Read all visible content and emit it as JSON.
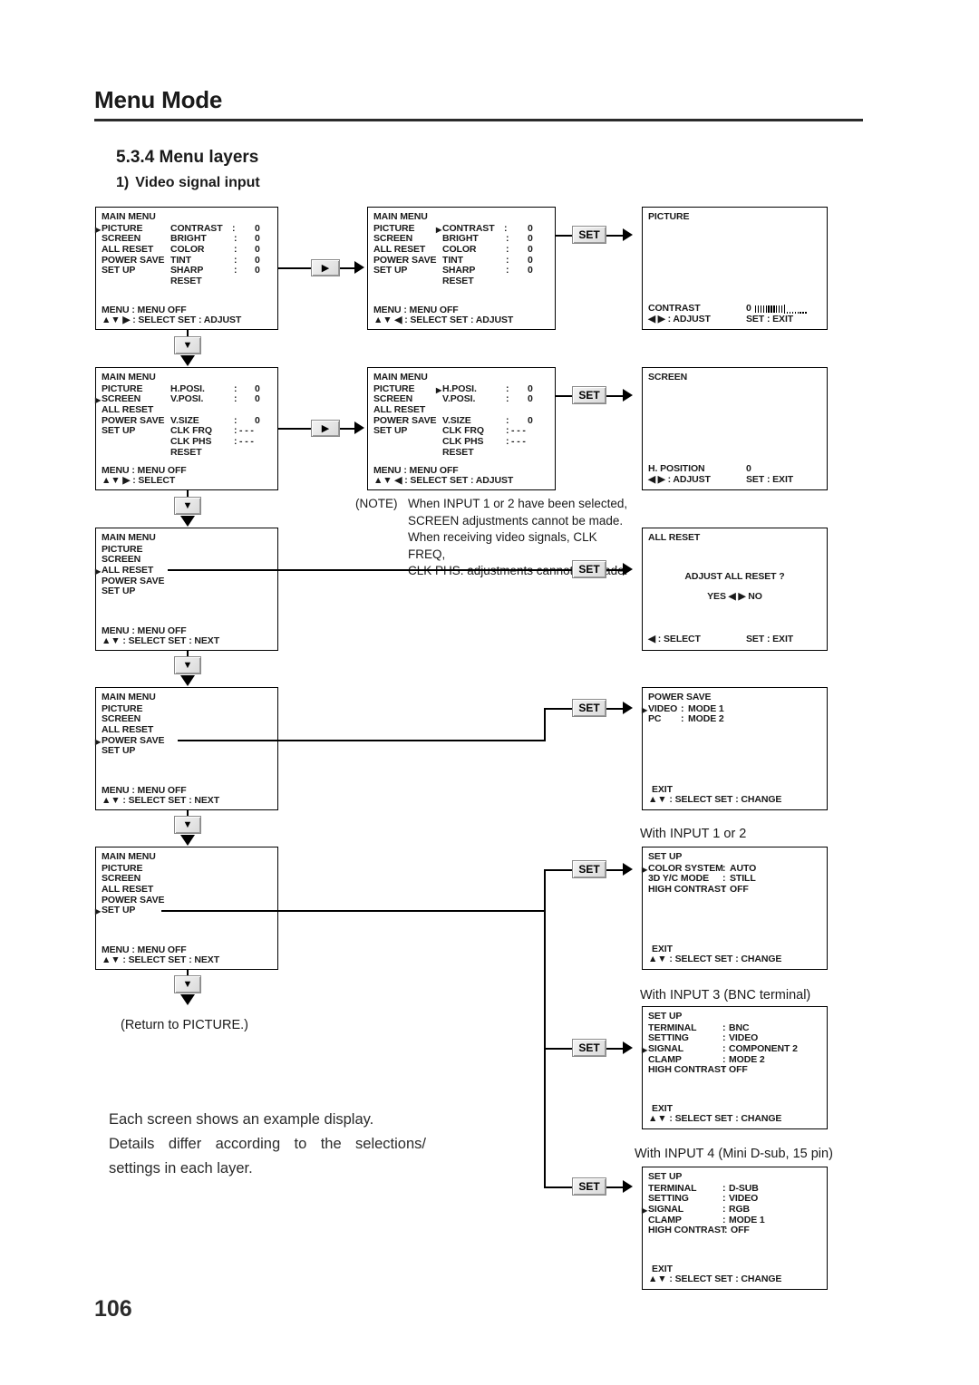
{
  "page": {
    "title": "Menu Mode",
    "section": "5.3.4 Menu layers",
    "subsection_number": "1)",
    "subsection": "Video signal input",
    "page_number": "106"
  },
  "buttons": {
    "set": "SET",
    "right_arrow": "▶",
    "down_arrow": "▼"
  },
  "panels": {
    "main_picture": {
      "header": "MAIN MENU",
      "left_items": [
        "PICTURE",
        "SCREEN",
        "ALL RESET",
        "POWER SAVE",
        "SET UP"
      ],
      "left_cursor_index": 0,
      "right_items": [
        {
          "label": "CONTRAST",
          "colon": ":",
          "value": "0"
        },
        {
          "label": "BRIGHT",
          "colon": ":",
          "value": "0"
        },
        {
          "label": "COLOR",
          "colon": ":",
          "value": "0"
        },
        {
          "label": "TINT",
          "colon": ":",
          "value": "0"
        },
        {
          "label": "SHARP",
          "colon": ":",
          "value": "0"
        },
        {
          "label": "RESET",
          "colon": "",
          "value": ""
        }
      ],
      "right_cursor_index": -1,
      "footer_line1": "MENU : MENU OFF",
      "footer_line2": "▲▼ ▶ : SELECT   SET : ADJUST"
    },
    "main_picture_contrast": {
      "header": "MAIN MENU",
      "left_items": [
        "PICTURE",
        "SCREEN",
        "ALL RESET",
        "POWER SAVE",
        "SET UP"
      ],
      "left_cursor_index": -1,
      "right_items": [
        {
          "label": "CONTRAST",
          "colon": ":",
          "value": "0"
        },
        {
          "label": "BRIGHT",
          "colon": ":",
          "value": "0"
        },
        {
          "label": "COLOR",
          "colon": ":",
          "value": "0"
        },
        {
          "label": "TINT",
          "colon": ":",
          "value": "0"
        },
        {
          "label": "SHARP",
          "colon": ":",
          "value": "0"
        },
        {
          "label": "RESET",
          "colon": "",
          "value": ""
        }
      ],
      "right_cursor_index": 0,
      "footer_line1": "MENU : MENU OFF",
      "footer_line2": "▲▼ ◀ : SELECT   SET : ADJUST"
    },
    "picture_screen": {
      "header": "PICTURE",
      "adjust_label": "CONTRAST",
      "adjust_value": "0",
      "footer_left": "◀ ▶ : ADJUST",
      "footer_right": "SET : EXIT"
    },
    "main_screen": {
      "header": "MAIN MENU",
      "left_items": [
        "PICTURE",
        "SCREEN",
        "ALL RESET",
        "POWER SAVE",
        "SET UP"
      ],
      "left_cursor_index": 1,
      "right_items": [
        {
          "label": "H.POSI.",
          "colon": ":",
          "value": "0"
        },
        {
          "label": "V.POSI.",
          "colon": ":",
          "value": "0"
        },
        {
          "label": "",
          "colon": "",
          "value": ""
        },
        {
          "label": "V.SIZE",
          "colon": ":",
          "value": "0"
        },
        {
          "label": "CLK FRQ",
          "colon": ":",
          "value": "- - -"
        },
        {
          "label": "CLK PHS",
          "colon": ":",
          "value": "- - -"
        },
        {
          "label": "RESET",
          "colon": "",
          "value": ""
        }
      ],
      "right_cursor_index": -1,
      "footer_line1": "MENU : MENU OFF",
      "footer_line2": "▲▼ ▶ : SELECT"
    },
    "main_screen_hposi": {
      "header": "MAIN MENU",
      "left_items": [
        "PICTURE",
        "SCREEN",
        "ALL RESET",
        "POWER SAVE",
        "SET UP"
      ],
      "left_cursor_index": -1,
      "right_items": [
        {
          "label": "H.POSI.",
          "colon": ":",
          "value": "0"
        },
        {
          "label": "V.POSI.",
          "colon": ":",
          "value": "0"
        },
        {
          "label": "",
          "colon": "",
          "value": ""
        },
        {
          "label": "V.SIZE",
          "colon": ":",
          "value": "0"
        },
        {
          "label": "CLK FRQ",
          "colon": ":",
          "value": "- - -"
        },
        {
          "label": "CLK PHS",
          "colon": ":",
          "value": "- - -"
        },
        {
          "label": "RESET",
          "colon": "",
          "value": ""
        }
      ],
      "right_cursor_index": 0,
      "footer_line1": "MENU : MENU OFF",
      "footer_line2": "▲▼ ◀ : SELECT   SET : ADJUST"
    },
    "screen_screen": {
      "header": "SCREEN",
      "adjust_label": "H. POSITION",
      "adjust_value": "0",
      "footer_left": "◀ ▶ : ADJUST",
      "footer_right": "SET : EXIT"
    },
    "main_allreset": {
      "header": "MAIN MENU",
      "left_items": [
        "PICTURE",
        "SCREEN",
        "ALL RESET",
        "POWER SAVE",
        "SET UP"
      ],
      "left_cursor_index": 2,
      "footer_line1": "MENU : MENU OFF",
      "footer_line2": "▲▼    : SELECT   SET : NEXT"
    },
    "allreset_screen": {
      "header": "ALL RESET",
      "prompt": "ADJUST ALL RESET ?",
      "choices": "YES ◀  ▶ NO",
      "footer_left": "◀    : SELECT",
      "footer_right": "SET : EXIT"
    },
    "main_powersave": {
      "header": "MAIN MENU",
      "left_items": [
        "PICTURE",
        "SCREEN",
        "ALL RESET",
        "POWER SAVE",
        "SET UP"
      ],
      "left_cursor_index": 3,
      "footer_line1": "MENU : MENU OFF",
      "footer_line2": "▲▼    : SELECT   SET : NEXT"
    },
    "powersave_screen": {
      "header": "POWER SAVE",
      "rows": [
        {
          "label": "VIDEO",
          "colon": ":",
          "value": "MODE 1",
          "cursor": true
        },
        {
          "label": "PC",
          "colon": ":",
          "value": "MODE 2",
          "cursor": false
        }
      ],
      "exit": "EXIT",
      "footer": "▲▼    : SELECT   SET : CHANGE"
    },
    "main_setup": {
      "header": "MAIN MENU",
      "left_items": [
        "PICTURE",
        "SCREEN",
        "ALL RESET",
        "POWER SAVE",
        "SET UP"
      ],
      "left_cursor_index": 4,
      "footer_line1": "MENU : MENU OFF",
      "footer_line2": "▲▼    : SELECT   SET : NEXT"
    },
    "setup_input12": {
      "caption": "With INPUT 1 or 2",
      "header": "SET UP",
      "rows": [
        {
          "label": "COLOR SYSTEM",
          "colon": ":",
          "value": "AUTO",
          "cursor": true
        },
        {
          "label": "3D Y/C MODE",
          "colon": ":",
          "value": "STILL",
          "cursor": false
        },
        {
          "label": "HIGH CONTRAST",
          "colon": ":",
          "value": "OFF",
          "cursor": false
        }
      ],
      "exit": "EXIT",
      "footer": "▲▼    : SELECT   SET : CHANGE"
    },
    "setup_input3": {
      "caption": "With INPUT 3 (BNC terminal)",
      "header": "SET UP",
      "rows": [
        {
          "label": "TERMINAL",
          "colon": ":",
          "value": "BNC",
          "cursor": false
        },
        {
          "label": "SETTING",
          "colon": ":",
          "value": "VIDEO",
          "cursor": false
        },
        {
          "label": "SIGNAL",
          "colon": ":",
          "value": "COMPONENT 2",
          "cursor": true
        },
        {
          "label": "CLAMP",
          "colon": ":",
          "value": "MODE 2",
          "cursor": false
        },
        {
          "label": "HIGH CONTRAST",
          "colon": ":",
          "value": "OFF",
          "cursor": false
        }
      ],
      "exit": "EXIT",
      "footer": "▲▼    : SELECT   SET : CHANGE"
    },
    "setup_input4": {
      "caption": "With INPUT 4 (Mini D-sub, 15 pin)",
      "header": "SET UP",
      "rows": [
        {
          "label": "TERMINAL",
          "colon": ":",
          "value": "D-SUB",
          "cursor": false
        },
        {
          "label": "SETTING",
          "colon": ":",
          "value": "VIDEO",
          "cursor": false
        },
        {
          "label": "SIGNAL",
          "colon": ":",
          "value": "RGB",
          "cursor": true
        },
        {
          "label": "CLAMP",
          "colon": ":",
          "value": "MODE 1",
          "cursor": false
        },
        {
          "label": "HIGH CONTRAST",
          "colon": ":",
          "value": "OFF",
          "cursor": false
        }
      ],
      "exit": "EXIT",
      "footer": "▲▼    : SELECT   SET : CHANGE"
    }
  },
  "notes": {
    "note_label": "(NOTE)",
    "note_lines": [
      "When INPUT 1 or 2 have been selected,",
      "SCREEN adjustments cannot be made.",
      "When receiving video signals, CLK FREQ,",
      "CLK PHS. adjustments cannot be made."
    ],
    "return_label": "(Return to PICTURE.)",
    "closing_lines": [
      "Each screen shows an example display.",
      "Details differ according to the selections/",
      "settings in each layer."
    ]
  }
}
